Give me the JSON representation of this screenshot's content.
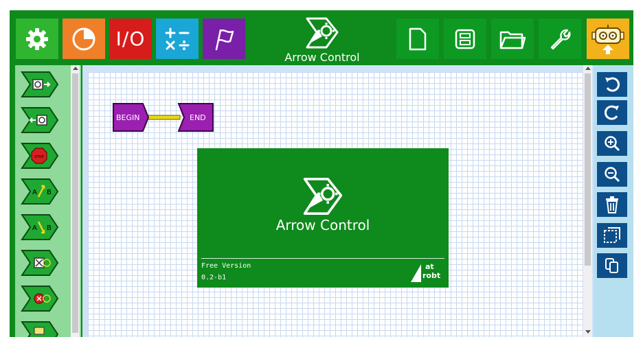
{
  "app": {
    "title": "Arrow Control",
    "logo_icon": "arrow-control-gear-logo-icon"
  },
  "toolbar_left": [
    {
      "name": "settings",
      "icon": "gear-icon",
      "color": "#2fb52f"
    },
    {
      "name": "timer",
      "icon": "pie-clock-icon",
      "color": "#f07f2a"
    },
    {
      "name": "io",
      "icon": "io-icon",
      "label": "I/O",
      "color": "#d71c1c"
    },
    {
      "name": "math",
      "icon": "math-operators-icon",
      "label": "+−\n×÷",
      "color": "#1aa6d6"
    },
    {
      "name": "flag",
      "icon": "flag-icon",
      "color": "#7a1fa8"
    }
  ],
  "toolbar_right": [
    {
      "name": "new-file",
      "icon": "new-file-icon"
    },
    {
      "name": "save",
      "icon": "save-icon"
    },
    {
      "name": "open",
      "icon": "folder-icon"
    },
    {
      "name": "tools",
      "icon": "wrench-icon"
    },
    {
      "name": "upload-robot",
      "icon": "robot-upload-icon",
      "color": "#f3b21b"
    }
  ],
  "palette": [
    {
      "icon": "motor-forward-icon"
    },
    {
      "icon": "motor-reverse-icon"
    },
    {
      "icon": "stop-sign-icon",
      "label": "STOP"
    },
    {
      "icon": "a-to-b-up-icon",
      "label_a": "A",
      "label_b": "B"
    },
    {
      "icon": "a-to-b-down-icon",
      "label_a": "A",
      "label_b": "B"
    },
    {
      "icon": "servo-icon"
    },
    {
      "icon": "servo-stop-icon"
    },
    {
      "icon": "partial-block-icon"
    }
  ],
  "flow": {
    "begin_label": "BEGIN",
    "end_label": "END",
    "block_color": "#9b1fb0",
    "connector_color": "#e6d81a"
  },
  "splash": {
    "title": "Arrow Control",
    "edition": "Free Version",
    "version": "0.2-b1",
    "brand_at": "at",
    "brand_robt": "robt"
  },
  "right_panel": [
    {
      "name": "undo",
      "icon": "undo-icon"
    },
    {
      "name": "redo",
      "icon": "redo-icon"
    },
    {
      "name": "zoom-in",
      "icon": "zoom-in-icon"
    },
    {
      "name": "zoom-out",
      "icon": "zoom-out-icon"
    },
    {
      "name": "delete",
      "icon": "trash-icon"
    },
    {
      "name": "select",
      "icon": "select-area-icon"
    },
    {
      "name": "copy",
      "icon": "copy-icon"
    }
  ],
  "colors": {
    "frame_green": "#0f8a1c",
    "palette_green": "#8fd99a",
    "right_panel_blue": "#b6dff0",
    "action_blue": "#0d4f8a",
    "grid_line": "#c6d8f0"
  }
}
